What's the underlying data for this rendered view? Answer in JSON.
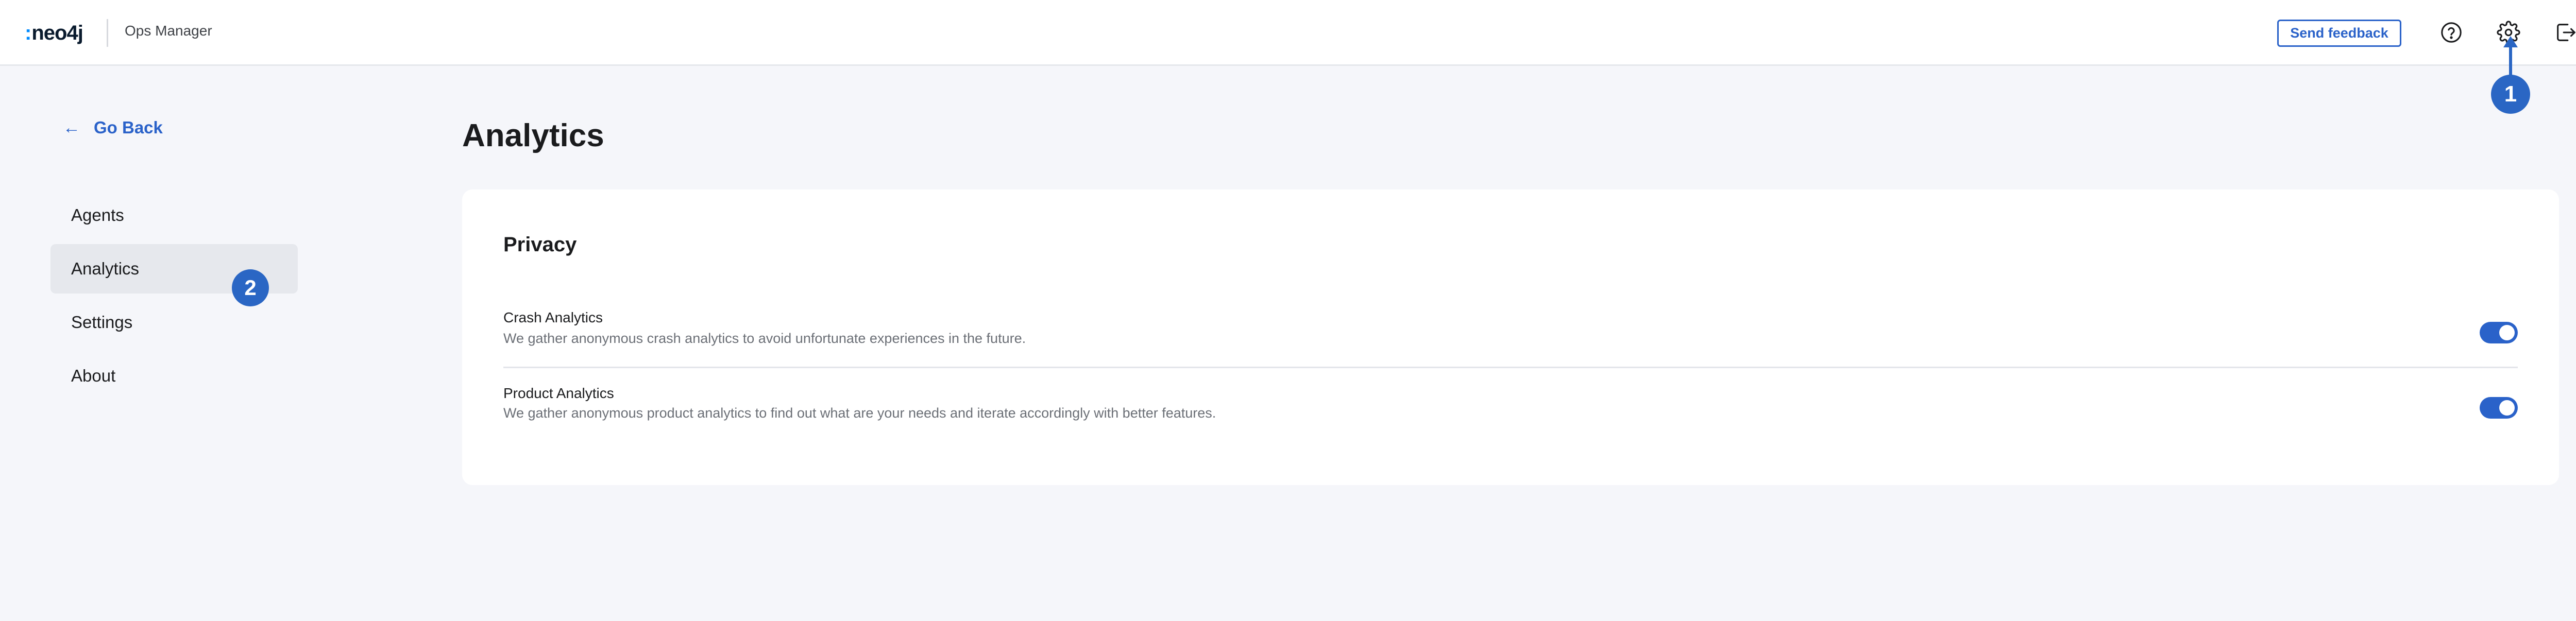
{
  "header": {
    "logo_text": "neo4j",
    "app_name": "Ops Manager",
    "feedback_label": "Send feedback",
    "icons": [
      "help-icon",
      "gear-icon",
      "logout-icon"
    ]
  },
  "callouts": {
    "one": "1",
    "two": "2"
  },
  "sidebar": {
    "back_label": "Go Back",
    "items": [
      {
        "label": "Agents",
        "active": false
      },
      {
        "label": "Analytics",
        "active": true
      },
      {
        "label": "Settings",
        "active": false
      },
      {
        "label": "About",
        "active": false
      }
    ]
  },
  "main": {
    "title": "Analytics",
    "card": {
      "title": "Privacy",
      "rows": [
        {
          "label": "Crash Analytics",
          "description": "We gather anonymous crash analytics to avoid unfortunate experiences in the future.",
          "enabled": true
        },
        {
          "label": "Product Analytics",
          "description": "We gather anonymous product analytics to find out what are your needs and iterate accordingly with better features.",
          "enabled": true
        }
      ]
    }
  },
  "colors": {
    "accent": "#2a62c9",
    "callout": "#2a66c4",
    "background": "#f5f6fa",
    "active_nav": "#e6e8ed"
  }
}
